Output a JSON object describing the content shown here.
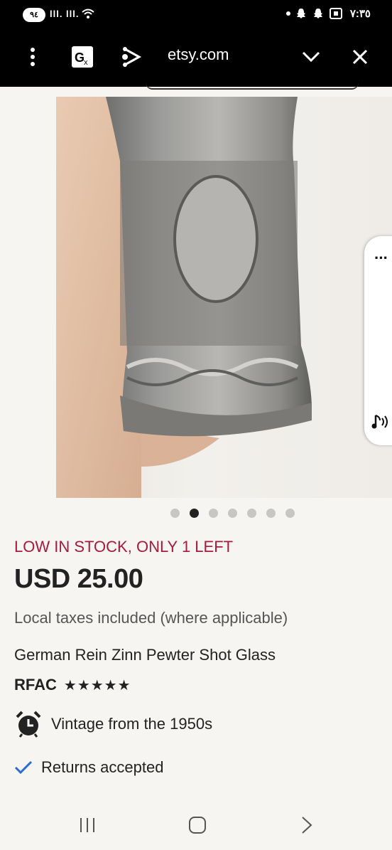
{
  "status_bar": {
    "battery": "٩٤",
    "signal_text": "lll. lll.",
    "time": "٧:٣٥"
  },
  "toolbar": {
    "url": "etsy.com"
  },
  "carousel": {
    "total": 7,
    "active_index": 1
  },
  "listing": {
    "stock_notice": "LOW IN STOCK, ONLY 1 LEFT",
    "price": "USD 25.00",
    "taxes_note": "Local taxes included (where applicable)",
    "title": "German Rein Zinn Pewter Shot Glass",
    "shop_name": "RFAC",
    "rating_stars": "★★★★★",
    "vintage_text": "Vintage from the 1950s",
    "returns_text": "Returns accepted"
  },
  "colors": {
    "stock_red": "#a61a3d",
    "check_blue": "#2a6bd1"
  },
  "icons": [
    "menu-dots-icon",
    "translate-icon",
    "share-icon",
    "chevron-down-icon",
    "close-icon",
    "more-dots-icon",
    "music-note-icon",
    "alarm-clock-icon",
    "checkmark-icon",
    "recents-icon",
    "home-icon",
    "back-icon"
  ]
}
